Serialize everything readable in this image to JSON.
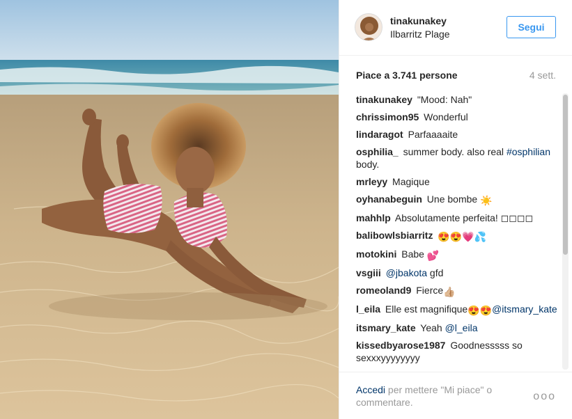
{
  "post": {
    "username": "tinakunakey",
    "location": "Ilbarritz Plage",
    "follow_label": "Segui",
    "likes_text": "Piace a 3.741 persone",
    "time_ago": "4 sett."
  },
  "comments": [
    {
      "user": "tinakunakey",
      "text": "\"Mood: Nah\""
    },
    {
      "user": "chrissimon95",
      "text": "Wonderful"
    },
    {
      "user": "lindaragot",
      "text": "Parfaaaaite"
    },
    {
      "user": "osphilia_",
      "text": "summer body. also real",
      "mention": "#osphilian",
      "text_after": " body."
    },
    {
      "user": "mrleyy",
      "text": "Magique"
    },
    {
      "user": "oyhanabeguin",
      "text": "Une bombe",
      "emoji": "☀️"
    },
    {
      "user": "mahhlp",
      "text": "Absolutamente perfeita! ◻◻◻◻"
    },
    {
      "user": "balibowlsbiarritz",
      "text": "",
      "emoji": "😍😍💗💦"
    },
    {
      "user": "motokini",
      "text": "Babe",
      "emoji": "💕"
    },
    {
      "user": "vsgiii",
      "mention": "@jbakota",
      "text_after": " gfd"
    },
    {
      "user": "romeoland9",
      "text": "Fierce",
      "emoji": "👍🏼"
    },
    {
      "user": "l_eila",
      "text": "Elle est magnifique",
      "emoji": "😍😍",
      "mention": "@itsmary_kate"
    },
    {
      "user": "itsmary_kate",
      "text": "Yeah",
      "mention": "@l_eila"
    },
    {
      "user": "kissedbyarose1987",
      "text": "Goodnesssss so sexxxyyyyyyyy"
    }
  ],
  "footer": {
    "login_label": "Accedi",
    "rest_text": "per mettere \"Mi piace\" o commentare.",
    "more_label": "ooo"
  },
  "icons": {
    "more": "more-options-icon"
  },
  "colors": {
    "accent": "#3897f0",
    "link": "#003569",
    "muted": "#999999"
  }
}
